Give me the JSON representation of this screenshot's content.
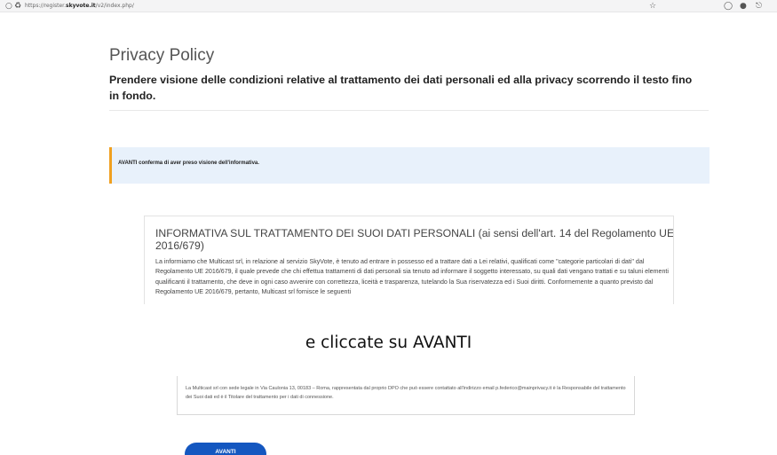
{
  "browser": {
    "url_prefix": "https://register.",
    "url_domain": "skyvote.it",
    "url_path": "/v2/index.php/",
    "icons": [
      "shield-icon",
      "lock-icon",
      "star-icon",
      "pocket-icon",
      "profile-icon",
      "extensions-icon"
    ]
  },
  "header": {
    "title": "Privacy Policy",
    "subtitle": "Prendere visione delle condizioni relative al trattamento dei dati personali ed alla privacy scorrendo il testo fino in fondo."
  },
  "notice": {
    "text": "AVANTI conferma di aver preso visione dell'informativa.",
    "accent_color": "#f0a020",
    "background": "#e8f1fb"
  },
  "policy": {
    "heading": "INFORMATIVA SUL TRATTAMENTO DEI SUOI DATI PERSONALI (ai sensi dell'art. 14 del Regolamento UE 2016/679)",
    "body": "La informiamo che Multicast srl, in relazione al servizio SkyVote, è tenuto ad entrare in possesso ed a trattare dati a Lei relativi, qualificati come \"categorie particolari di dati\" dal Regolamento UE 2016/679, il quale prevede che chi effettua trattamenti di dati personali sia tenuto ad informare il soggetto interessato, su quali dati vengano trattati e su taluni elementi qualificanti il trattamento, che deve in ogni caso avvenire con correttezza, liceità e trasparenza, tutelando la Sua riservatezza ed i Suoi diritti. Conformemente a quanto previsto dal Regolamento UE 2016/679, pertanto, Multicast srl fornisce le seguenti"
  },
  "caption": "e cliccate su AVANTI",
  "lower": {
    "text": "La Multicast srl con sede legale in Via Caulonia 13, 00183 – Roma, rappresentata dal proprio DPO che può essere contattato all'indirizzo email p.federico@mainprivacy.it è la Responsabile del trattamento dei Suoi dati ed è il Titolare del trattamento per i dati di connessione."
  },
  "button": {
    "label": "AVANTI",
    "color": "#1457c0"
  }
}
